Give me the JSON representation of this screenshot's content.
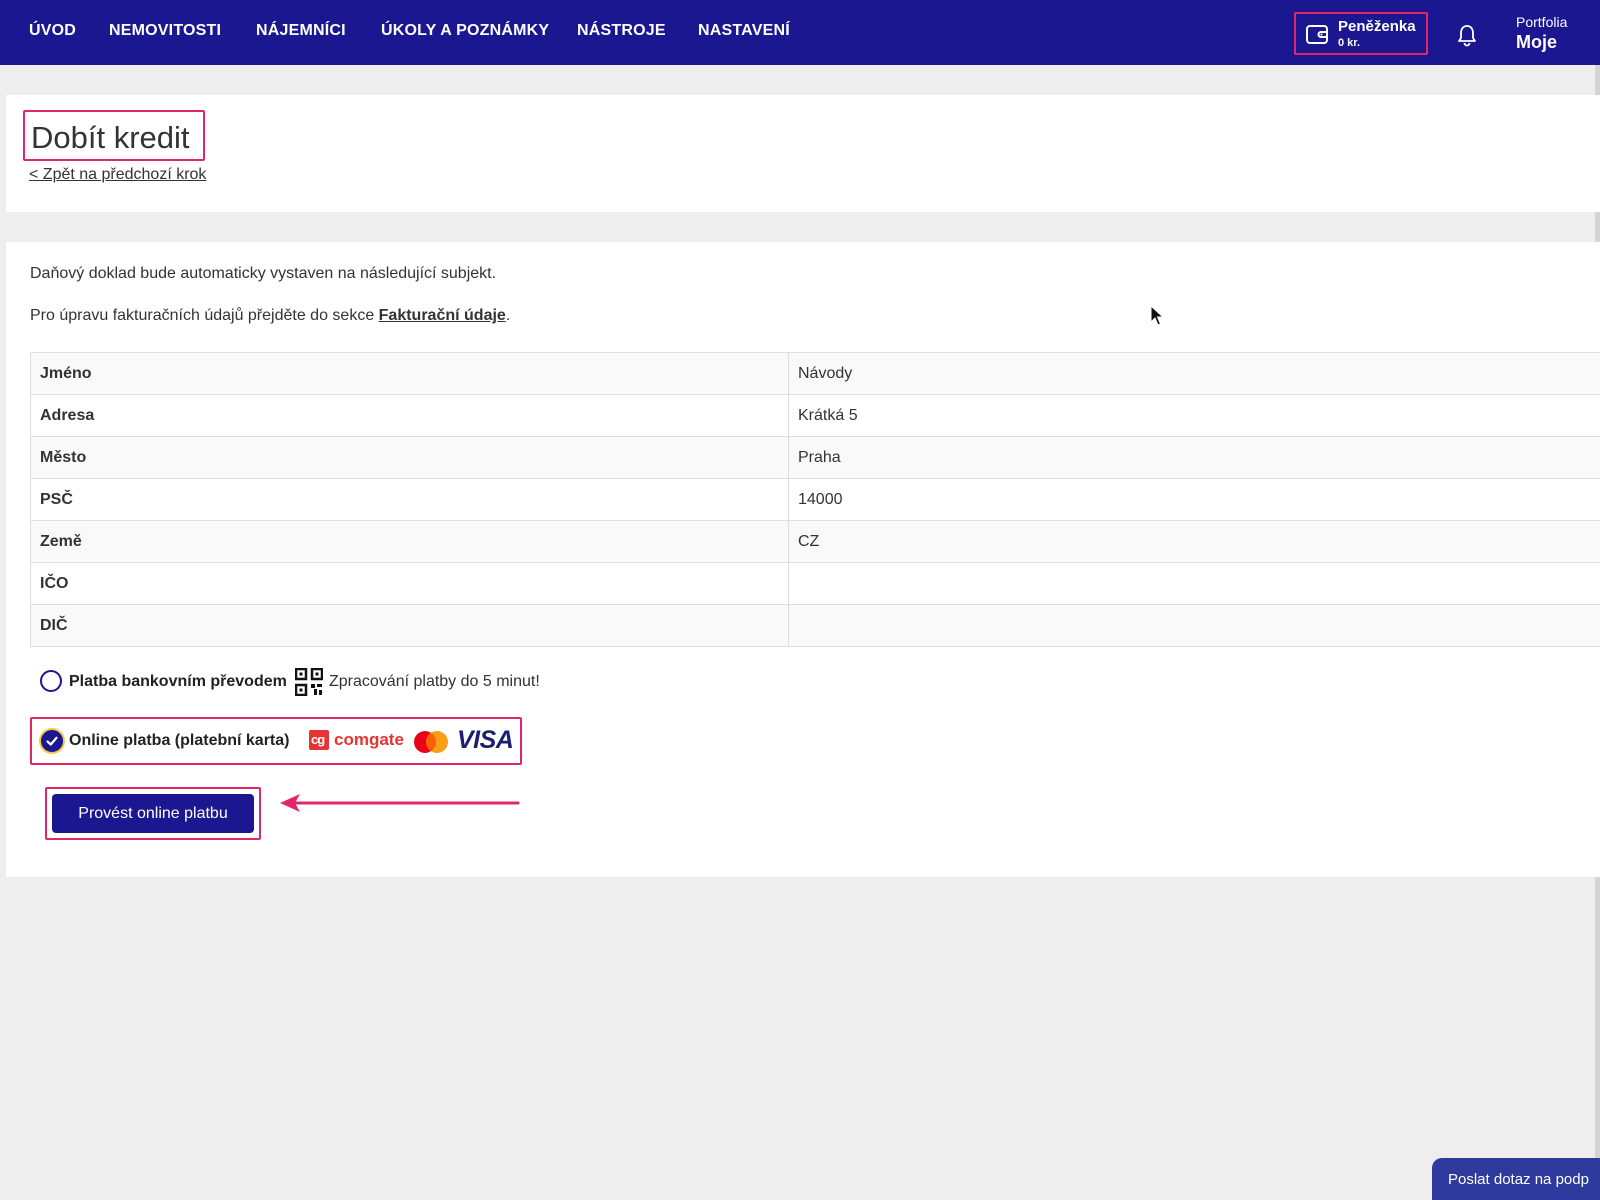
{
  "nav": {
    "items": [
      {
        "label": "ÚVOD"
      },
      {
        "label": "NEMOVITOSTI"
      },
      {
        "label": "NÁJEMNÍCI"
      },
      {
        "label": "ÚKOLY A POZNÁMKY"
      },
      {
        "label": "NÁSTROJE"
      },
      {
        "label": "NASTAVENÍ"
      }
    ],
    "wallet": {
      "title": "Peněženka",
      "amount": "0 kr."
    },
    "portfolio": {
      "label": "Portfolia",
      "value": "Moje"
    }
  },
  "header": {
    "title": "Dobít kredit",
    "back_link": "< Zpět na předchozí krok"
  },
  "main": {
    "info_text": "Daňový doklad bude automaticky vystaven na následující subjekt.",
    "billing_prefix": "Pro úpravu fakturačních údajů přejděte do sekce ",
    "billing_link": "Fakturační údaje",
    "billing_suffix": ".",
    "table": [
      {
        "key": "Jméno",
        "value": "Návody"
      },
      {
        "key": "Adresa",
        "value": "Krátká 5"
      },
      {
        "key": "Město",
        "value": "Praha"
      },
      {
        "key": "PSČ",
        "value": "14000"
      },
      {
        "key": "Země",
        "value": "CZ"
      },
      {
        "key": "IČO",
        "value": ""
      },
      {
        "key": "DIČ",
        "value": ""
      }
    ],
    "payment": {
      "bank": {
        "label": "Platba bankovním převodem",
        "note": "Zpracování platby do 5 minut!",
        "selected": false
      },
      "online": {
        "label": "Online platba (platební karta)",
        "selected": true,
        "brand_comgate": "comgate",
        "brand_comgate_mark": "cg",
        "brand_visa": "VISA"
      }
    },
    "submit_label": "Provést online platbu"
  },
  "support": {
    "label": "Poslat dotaz na podp"
  },
  "colors": {
    "nav_bg": "#1b1791",
    "highlight": "#e0276e",
    "button": "#1b1791",
    "page_bg": "#eeeeee"
  }
}
